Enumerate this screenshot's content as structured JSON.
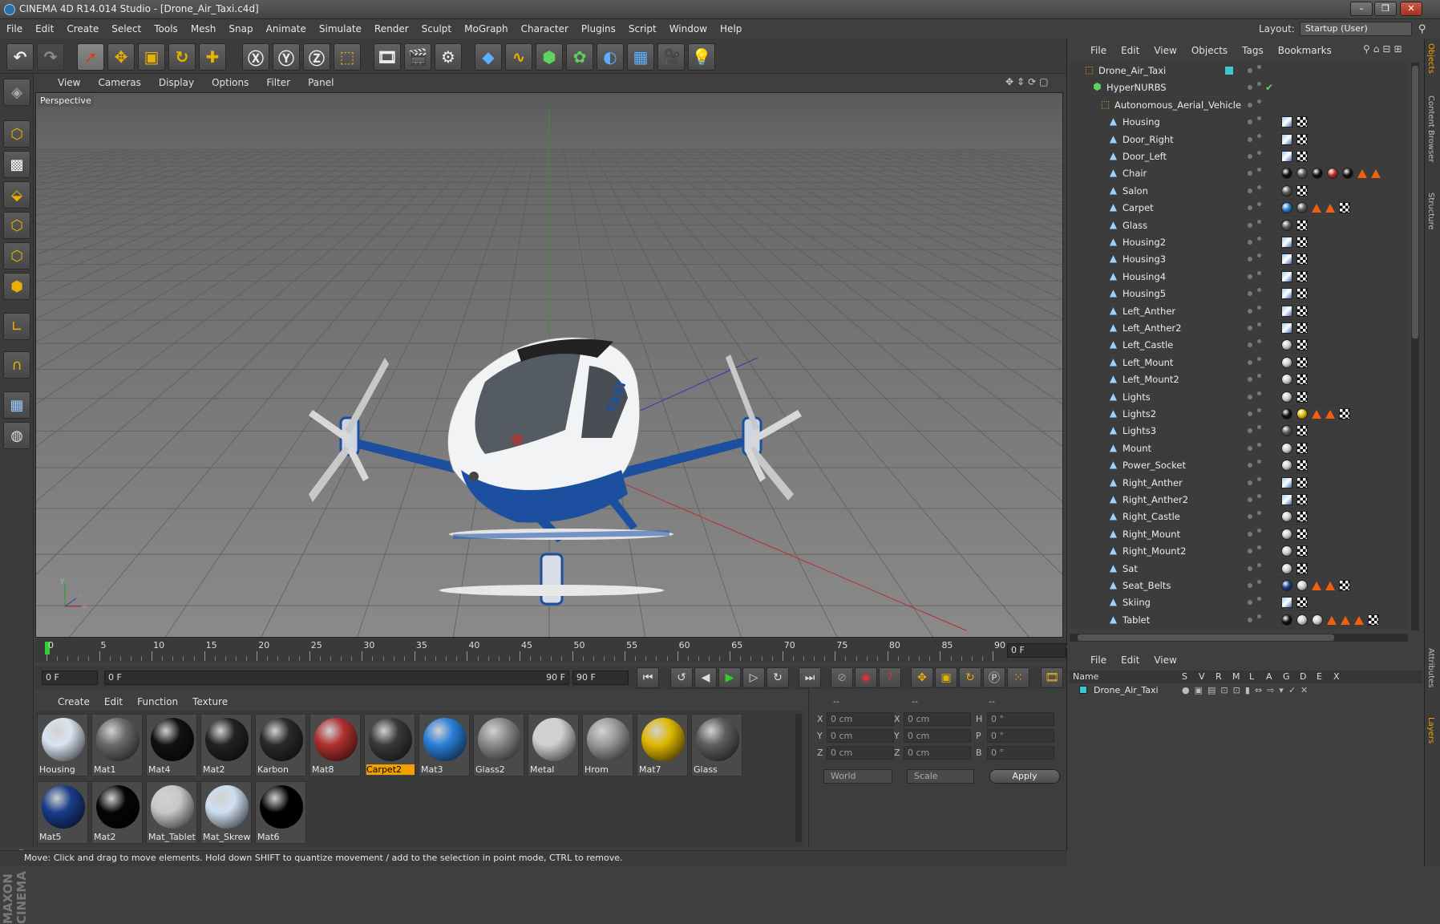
{
  "window": {
    "title": "CINEMA 4D R14.014 Studio - [Drone_Air_Taxi.c4d]"
  },
  "menubar": [
    "File",
    "Edit",
    "Create",
    "Select",
    "Tools",
    "Mesh",
    "Snap",
    "Animate",
    "Simulate",
    "Render",
    "Sculpt",
    "MoGraph",
    "Character",
    "Plugins",
    "Script",
    "Window",
    "Help"
  ],
  "layout": {
    "label": "Layout:",
    "value": "Startup (User)"
  },
  "viewport": {
    "menu": [
      "View",
      "Cameras",
      "Display",
      "Options",
      "Filter",
      "Panel"
    ],
    "label": "Perspective"
  },
  "timeline": {
    "ticks": [
      "0",
      "5",
      "10",
      "15",
      "20",
      "25",
      "30",
      "35",
      "40",
      "45",
      "50",
      "55",
      "60",
      "65",
      "70",
      "75",
      "80",
      "85",
      "90"
    ],
    "current_frame": "0 F",
    "start": "0 F",
    "range_start": "0 F",
    "range_end": "90 F",
    "end": "90 F"
  },
  "materials_panel": {
    "menu": [
      "Create",
      "Edit",
      "Function",
      "Texture"
    ],
    "materials": [
      {
        "name": "Housing",
        "color": "#d8e4f0",
        "selected": false
      },
      {
        "name": "Mat1",
        "color": "#6a6a6a",
        "selected": false
      },
      {
        "name": "Mat4",
        "color": "#111111",
        "selected": false
      },
      {
        "name": "Mat2",
        "color": "#222222",
        "selected": false
      },
      {
        "name": "Karbon",
        "color": "#2a2a2a",
        "selected": false
      },
      {
        "name": "Mat8",
        "color": "#b03030",
        "selected": false
      },
      {
        "name": "Carpet2",
        "color": "#3a3a3a",
        "selected": true
      },
      {
        "name": "Mat3",
        "color": "#2a7fd8",
        "selected": false
      },
      {
        "name": "Glass2",
        "color": "#8a8a8a",
        "selected": false
      },
      {
        "name": "Metal",
        "color": "#d0d0d0",
        "selected": false
      },
      {
        "name": "Hrom",
        "color": "#9a9a9a",
        "selected": false
      },
      {
        "name": "Mat7",
        "color": "#e0b800",
        "selected": false
      },
      {
        "name": "Glass",
        "color": "#5e5e5e",
        "selected": false
      },
      {
        "name": "Mat5",
        "color": "#1a3c8a",
        "selected": false
      },
      {
        "name": "Mat2",
        "color": "#050505",
        "selected": false
      },
      {
        "name": "Mat_Tablet",
        "color": "#c8c8c8",
        "selected": false
      },
      {
        "name": "Mat_Skrew",
        "color": "#cfdff0",
        "selected": false
      },
      {
        "name": "Mat6",
        "color": "#000000",
        "selected": false
      }
    ]
  },
  "coords": {
    "header": [
      "--",
      "--",
      "--"
    ],
    "rows": [
      {
        "a": "X",
        "av": "0 cm",
        "b": "X",
        "bv": "0 cm",
        "c": "H",
        "cv": "0 °"
      },
      {
        "a": "Y",
        "av": "0 cm",
        "b": "Y",
        "bv": "0 cm",
        "c": "P",
        "cv": "0 °"
      },
      {
        "a": "Z",
        "av": "0 cm",
        "b": "Z",
        "bv": "0 cm",
        "c": "B",
        "cv": "0 °"
      }
    ],
    "space": "World",
    "mode": "Scale",
    "apply": "Apply"
  },
  "status": "Move: Click and drag to move elements. Hold down SHIFT to quantize movement / add to the selection in point mode, CTRL to remove.",
  "objects_panel": {
    "menu": [
      "File",
      "Edit",
      "View",
      "Objects",
      "Tags",
      "Bookmarks"
    ],
    "items": [
      {
        "name": "Drone_Air_Taxi",
        "depth": 0,
        "icon": "null",
        "tags": ""
      },
      {
        "name": "HyperNURBS",
        "depth": 1,
        "icon": "nurbs",
        "tags": ""
      },
      {
        "name": "Autonomous_Aerial_Vehicle",
        "depth": 2,
        "icon": "null",
        "tags": ""
      },
      {
        "name": "Housing",
        "depth": 3,
        "icon": "poly",
        "tags": "pc"
      },
      {
        "name": "Door_Right",
        "depth": 3,
        "icon": "poly",
        "tags": "pc"
      },
      {
        "name": "Door_Left",
        "depth": 3,
        "icon": "poly",
        "tags": "pc"
      },
      {
        "name": "Chair",
        "depth": 3,
        "icon": "poly",
        "tags": "kgkrktt"
      },
      {
        "name": "Salon",
        "depth": 3,
        "icon": "poly",
        "tags": "gc"
      },
      {
        "name": "Carpet",
        "depth": 3,
        "icon": "poly",
        "tags": "bgttc"
      },
      {
        "name": "Glass",
        "depth": 3,
        "icon": "poly",
        "tags": "gc"
      },
      {
        "name": "Housing2",
        "depth": 3,
        "icon": "poly",
        "tags": "pc"
      },
      {
        "name": "Housing3",
        "depth": 3,
        "icon": "poly",
        "tags": "pc"
      },
      {
        "name": "Housing4",
        "depth": 3,
        "icon": "poly",
        "tags": "pc"
      },
      {
        "name": "Housing5",
        "depth": 3,
        "icon": "poly",
        "tags": "pc"
      },
      {
        "name": "Left_Anther",
        "depth": 3,
        "icon": "poly",
        "tags": "pc"
      },
      {
        "name": "Left_Anther2",
        "depth": 3,
        "icon": "poly",
        "tags": "pc"
      },
      {
        "name": "Left_Castle",
        "depth": 3,
        "icon": "poly",
        "tags": "wc"
      },
      {
        "name": "Left_Mount",
        "depth": 3,
        "icon": "poly",
        "tags": "wc"
      },
      {
        "name": "Left_Mount2",
        "depth": 3,
        "icon": "poly",
        "tags": "wc"
      },
      {
        "name": "Lights",
        "depth": 3,
        "icon": "poly",
        "tags": "wc"
      },
      {
        "name": "Lights2",
        "depth": 3,
        "icon": "poly",
        "tags": "kyttc"
      },
      {
        "name": "Lights3",
        "depth": 3,
        "icon": "poly",
        "tags": "gc"
      },
      {
        "name": "Mount",
        "depth": 3,
        "icon": "poly",
        "tags": "wc"
      },
      {
        "name": "Power_Socket",
        "depth": 3,
        "icon": "poly",
        "tags": "wc"
      },
      {
        "name": "Right_Anther",
        "depth": 3,
        "icon": "poly",
        "tags": "pc"
      },
      {
        "name": "Right_Anther2",
        "depth": 3,
        "icon": "poly",
        "tags": "pc"
      },
      {
        "name": "Right_Castle",
        "depth": 3,
        "icon": "poly",
        "tags": "wc"
      },
      {
        "name": "Right_Mount",
        "depth": 3,
        "icon": "poly",
        "tags": "wc"
      },
      {
        "name": "Right_Mount2",
        "depth": 3,
        "icon": "poly",
        "tags": "wc"
      },
      {
        "name": "Sat",
        "depth": 3,
        "icon": "poly",
        "tags": "wc"
      },
      {
        "name": "Seat_Belts",
        "depth": 3,
        "icon": "poly",
        "tags": "nwttc"
      },
      {
        "name": "Skiing",
        "depth": 3,
        "icon": "poly",
        "tags": "pc"
      },
      {
        "name": "Tablet",
        "depth": 3,
        "icon": "poly",
        "tags": "kwwtttc"
      }
    ]
  },
  "side_tabs": [
    "Objects",
    "Content Browser",
    "Structure"
  ],
  "side_tabs2": [
    "Attributes",
    "Layers"
  ],
  "attributes_panel": {
    "menu": [
      "File",
      "Edit",
      "View"
    ],
    "columns": [
      "Name",
      "S",
      "V",
      "R",
      "M",
      "L",
      "A",
      "G",
      "D",
      "E",
      "X"
    ],
    "row_name": "Drone_Air_Taxi"
  }
}
